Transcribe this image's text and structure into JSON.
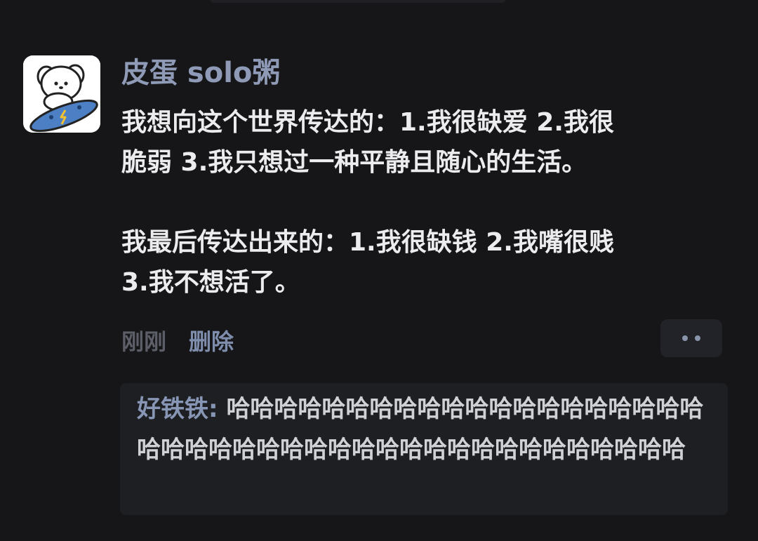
{
  "post": {
    "username": "皮蛋 solo粥",
    "body_lines": [
      "我想向这个世界传达的：1.我很缺爱 2.我很",
      "脆弱 3.我只想过一种平静且随心的生活。",
      "",
      "我最后传达出来的：1.我很缺钱 2.我嘴很贱",
      "3.我不想活了。"
    ],
    "time": "刚刚",
    "delete_label": "删除"
  },
  "reply": {
    "author": "好铁铁: ",
    "text": "哈哈哈哈哈哈哈哈哈哈哈哈哈哈哈哈哈哈哈哈哈哈哈哈哈哈哈哈哈哈哈哈哈哈哈哈哈哈哈哈哈哈哈"
  },
  "colors": {
    "background": "#161618",
    "username": "#8e9ab6",
    "text": "#ececee",
    "link": "#7f8dad"
  },
  "icons": {
    "avatar": "puppy-on-skateboard-avatar",
    "more": "more-dots-icon"
  }
}
